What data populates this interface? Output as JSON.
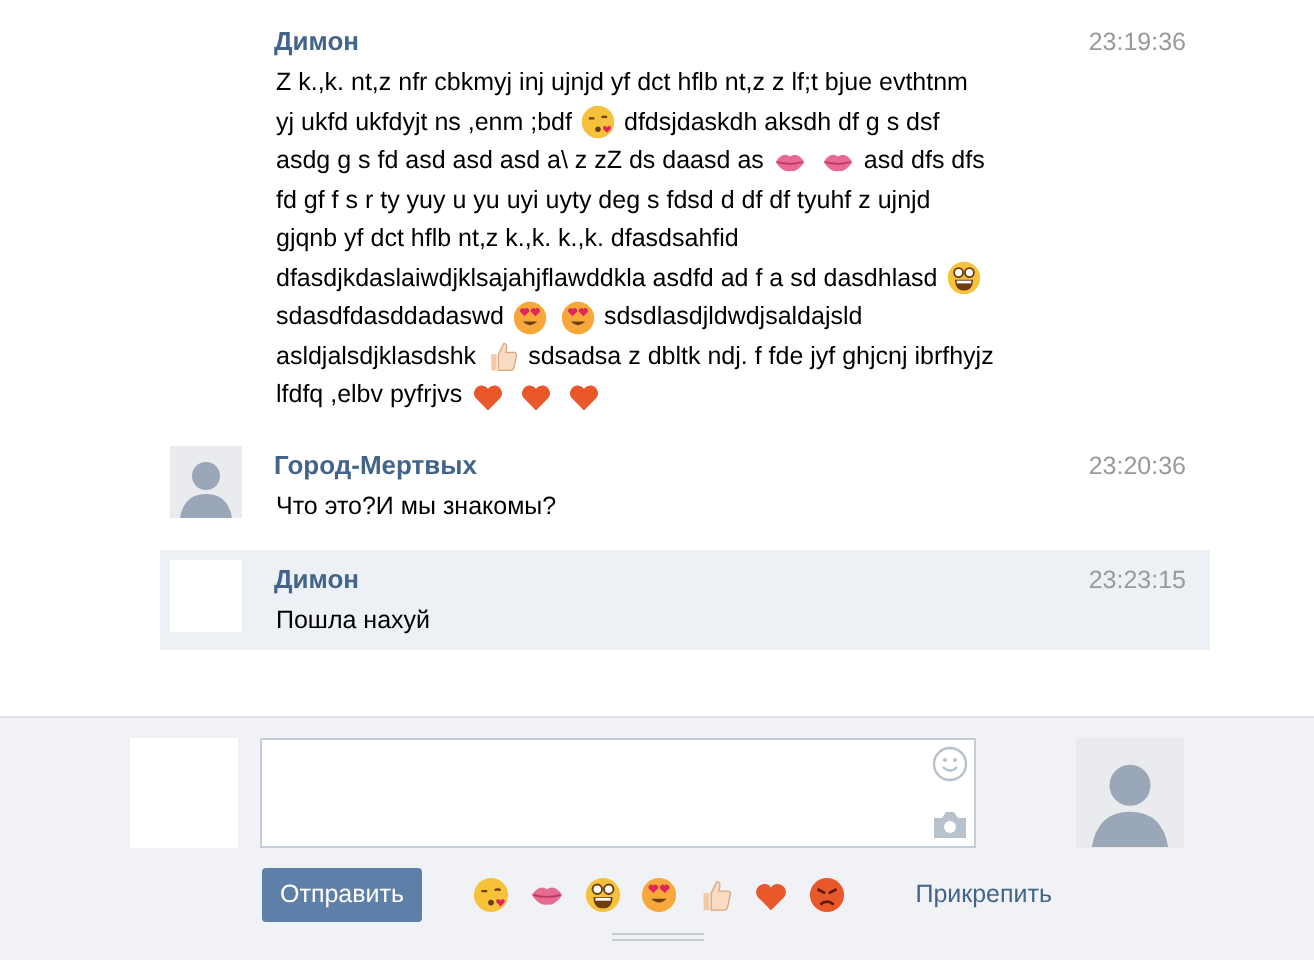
{
  "messages": [
    {
      "author": "Димон",
      "time": "23:19:36",
      "highlighted": false,
      "lines": [
        [
          {
            "kind": "text",
            "text": "Z k.,k. nt,z nfr cbkmyj inj ujnjd yf dct hflb nt,z z lf;t bjue evthtnm"
          }
        ],
        [
          {
            "kind": "text",
            "text": "yj ukfd ukfdyjt ns ,enm ;bdf"
          },
          {
            "kind": "kiss"
          },
          {
            "kind": "text",
            "text": "dfdsjdaskdh aksdh df g s dsf"
          }
        ],
        [
          {
            "kind": "text",
            "text": "asdg g s fd asd asd asd a\\ z zZ ds daasd as"
          },
          {
            "kind": "lips"
          },
          {
            "kind": "lips"
          },
          {
            "kind": "text",
            "text": "asd dfs dfs"
          }
        ],
        [
          {
            "kind": "text",
            "text": "fd gf f s r ty yuy u yu uyi uyty deg s fdsd d df df tyuhf z ujnjd"
          }
        ],
        [
          {
            "kind": "text",
            "text": "gjqnb yf dct hflb nt,z k.,k. k.,k. dfasdsahfid"
          }
        ],
        [
          {
            "kind": "text",
            "text": "dfasdjkdaslaiwdjklsajahjflawddkla asdfd ad f a sd dasdhlasd"
          },
          {
            "kind": "grin"
          }
        ],
        [
          {
            "kind": "text",
            "text": "sdasdfdasddadaswd"
          },
          {
            "kind": "hearteyes"
          },
          {
            "kind": "hearteyes"
          },
          {
            "kind": "text",
            "text": "sdsdlasdjldwdjsaldajsld"
          }
        ],
        [
          {
            "kind": "text",
            "text": "asldjalsdjklasdshk"
          },
          {
            "kind": "thumbsup"
          },
          {
            "kind": "text",
            "text": "sdsadsa z dbltk ndj. f fde jyf ghjcnj ibrfhyjz"
          }
        ],
        [
          {
            "kind": "text",
            "text": "lfdfq ,elbv pyfrjvs"
          },
          {
            "kind": "heart"
          },
          {
            "kind": "heart"
          },
          {
            "kind": "heart"
          }
        ]
      ]
    },
    {
      "author": "Город-Мертвых",
      "time": "23:20:36",
      "photo": true,
      "highlighted": false,
      "lines": [
        [
          {
            "kind": "text",
            "text": "Что это?И мы знакомы?"
          }
        ]
      ]
    },
    {
      "author": "Димон",
      "time": "23:23:15",
      "photo": false,
      "highlighted": true,
      "lines": [
        [
          {
            "kind": "text",
            "text": "Пошла нахуй"
          }
        ]
      ]
    }
  ],
  "composer": {
    "send_button": "Отправить",
    "emoji_bar": [
      {
        "kind": "kiss"
      },
      {
        "kind": "lips"
      },
      {
        "kind": "grin"
      },
      {
        "kind": "hearteyes"
      },
      {
        "kind": "thumbsup"
      },
      {
        "kind": "heart"
      },
      {
        "kind": "angry"
      }
    ],
    "attach_link": "Прикрепить"
  }
}
